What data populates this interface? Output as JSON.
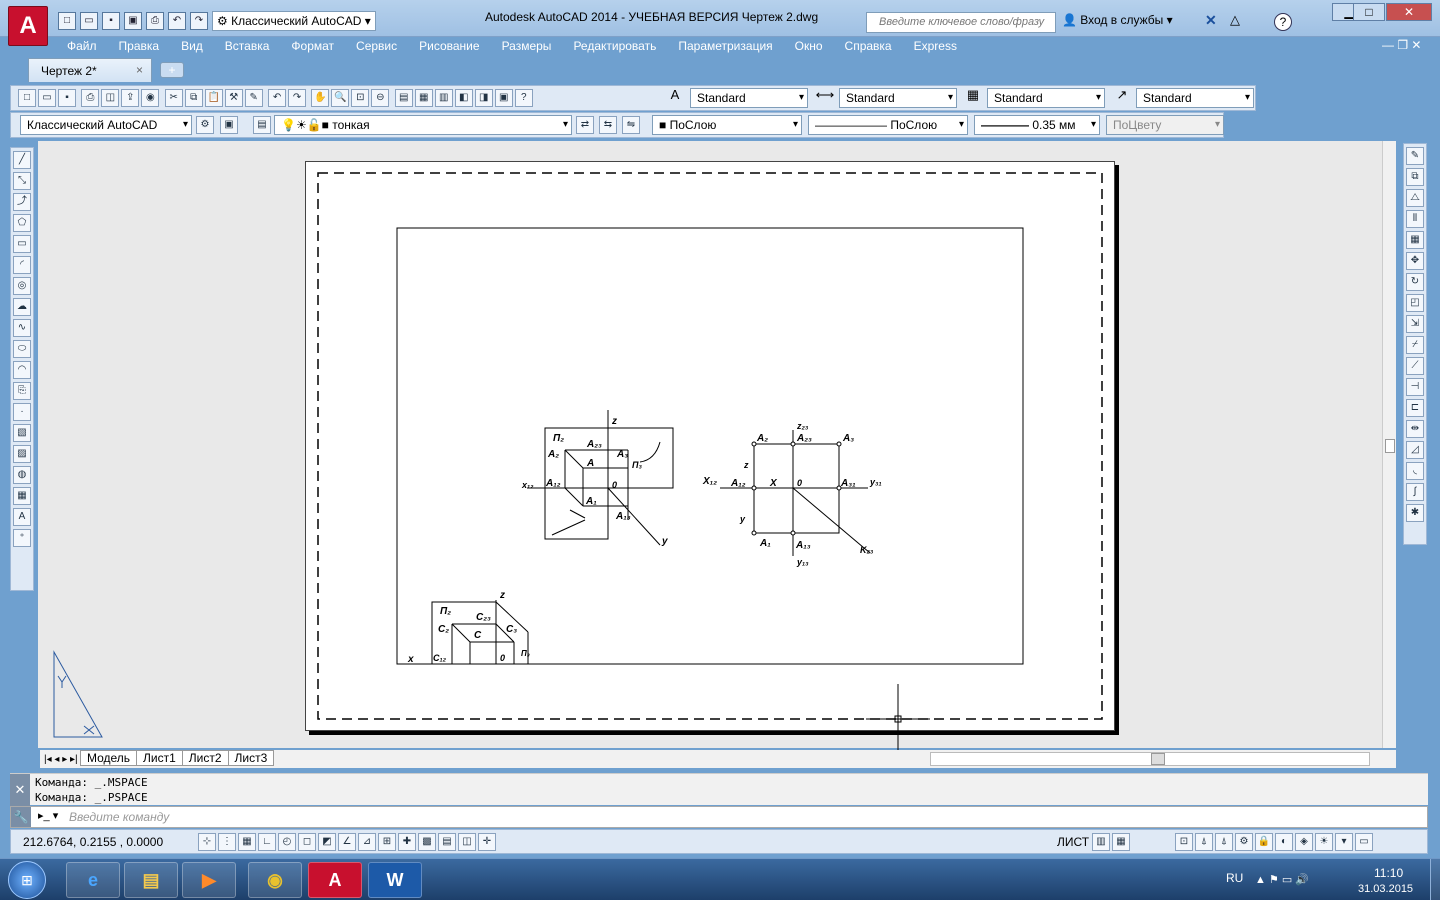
{
  "window": {
    "title": "Autodesk AutoCAD 2014 - УЧЕБНАЯ ВЕРСИЯ      Чертеж 2.dwg",
    "workspace": "Классический AutoCAD",
    "search_placeholder": "Введите ключевое слово/фразу",
    "signin": "Вход в службы",
    "help": "?"
  },
  "menu": [
    "Файл",
    "Правка",
    "Вид",
    "Вставка",
    "Формат",
    "Сервис",
    "Рисование",
    "Размеры",
    "Редактировать",
    "Параметризация",
    "Окно",
    "Справка",
    "Express"
  ],
  "doc_tab": {
    "label": "Чертеж 2*",
    "close": "×"
  },
  "styles": {
    "text_style": "Standard",
    "dim_style": "Standard",
    "table_style": "Standard",
    "mleader_style": "Standard"
  },
  "layers": {
    "workspace": "Классический AutoCAD",
    "layer": "тонкая",
    "color": "ПоСлою",
    "linetype": "ПоСлою",
    "lineweight": "0.35 мм",
    "plotstyle": "ПоЦвету"
  },
  "layout_tabs": [
    "Модель",
    "Лист1",
    "Лист2",
    "Лист3"
  ],
  "command": {
    "history": [
      "Команда:  _.MSPACE",
      "Команда:  _.PSPACE"
    ],
    "placeholder": "Введите команду"
  },
  "status": {
    "coords": "212.6764, 0.2155  , 0.0000",
    "space": "ЛИСТ"
  },
  "taskbar": {
    "lang": "RU",
    "time": "11:10",
    "date": "31.03.2015"
  },
  "drawing": {
    "left": {
      "z": "z",
      "y": "y",
      "x": "x₁₂",
      "pi2": "П₂",
      "A2": "A₂",
      "A23": "A₂₃",
      "A": "A",
      "A3": "A₃",
      "A12": "A₁₂",
      "O": "0",
      "A1": "A₁",
      "A13": "A₁₃",
      "pi3": "П₃"
    },
    "right": {
      "z": "z₂₃",
      "A2": "A₂",
      "A23": "A₂₃",
      "A3": "A₃",
      "X12": "X₁₂",
      "A12": "A₁₂",
      "X": "X",
      "O": "0",
      "A31": "A₃₁",
      "y31": "y₃₁",
      "zl": "z",
      "yl": "y",
      "A1": "A₁",
      "A13": "A₁₃",
      "y13": "y₁₃",
      "k": "K₂₃"
    },
    "bottom": {
      "z": "z",
      "pi2": "П₂",
      "C2": "C₂",
      "C23": "C₂₃",
      "C": "C",
      "C3": "C₃",
      "x": "x",
      "C12": "C₁₂",
      "O": "0",
      "pi3": "П₃"
    }
  }
}
